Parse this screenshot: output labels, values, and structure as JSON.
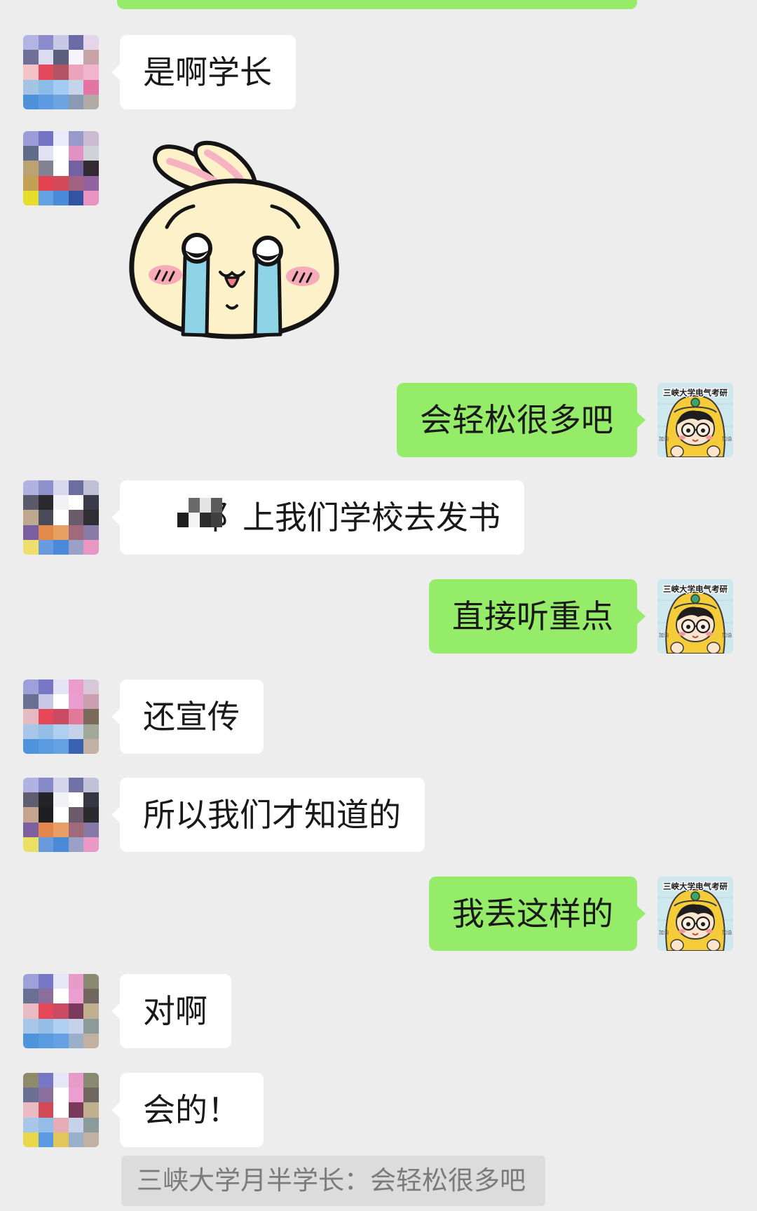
{
  "theme": {
    "background": "#ededed",
    "bubble_self": "#95ec69",
    "bubble_other": "#ffffff",
    "text": "#191919",
    "quote_bg": "#dcdcdc",
    "quote_text": "#7b7b7b"
  },
  "messages": [
    {
      "side": "left",
      "text": "是啊学长"
    },
    {
      "side": "left",
      "sticker": "crying-bunny-icon"
    },
    {
      "side": "right",
      "text": "会轻松很多吧"
    },
    {
      "side": "left",
      "text": "阝上我们学校去发书"
    },
    {
      "side": "right",
      "text": "直接听重点"
    },
    {
      "side": "left",
      "text": "还宣传"
    },
    {
      "side": "left",
      "text": "所以我们才知道的"
    },
    {
      "side": "right",
      "text": "我丢这样的"
    },
    {
      "side": "left",
      "text": "对啊"
    },
    {
      "side": "left",
      "text": "会的！"
    }
  ],
  "self_avatar": {
    "caption": "三峡大学电气考研",
    "side_text": "加油"
  },
  "quote": {
    "text": "三峡大学月半学长：会轻松很多吧"
  }
}
